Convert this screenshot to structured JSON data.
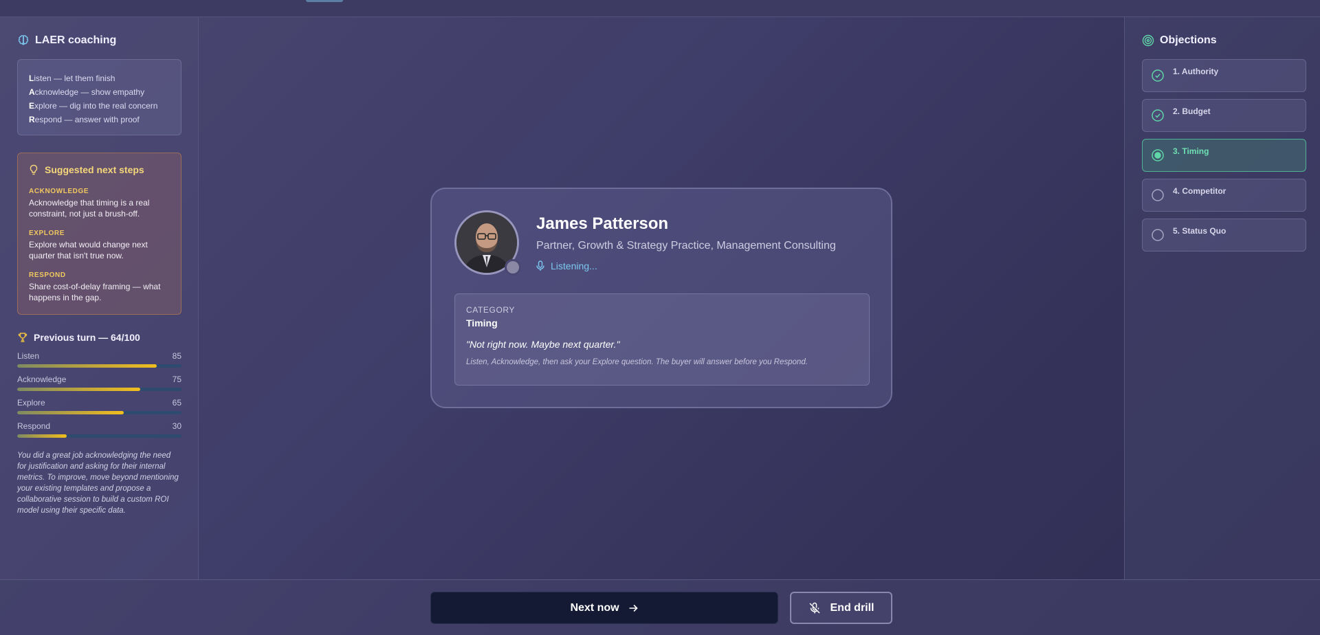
{
  "colors": {
    "accent_green": "#6ee0b4",
    "accent_yellow": "#f5d77a",
    "listening_blue": "#7cc8f0",
    "primary_button": "#141a33"
  },
  "coaching": {
    "title": "LAER coaching",
    "icon": "brain-icon",
    "laer": [
      {
        "letter": "L",
        "rest": "isten — let them finish"
      },
      {
        "letter": "A",
        "rest": "cknowledge — show empathy"
      },
      {
        "letter": "E",
        "rest": "xplore — dig into the real concern"
      },
      {
        "letter": "R",
        "rest": "espond — answer with proof"
      }
    ]
  },
  "suggested": {
    "title": "Suggested next steps",
    "icon": "lightbulb-icon",
    "steps": [
      {
        "label": "ACKNOWLEDGE",
        "text": "Acknowledge that timing is a real constraint, not just a brush-off."
      },
      {
        "label": "EXPLORE",
        "text": "Explore what would change next quarter that isn't true now."
      },
      {
        "label": "RESPOND",
        "text": "Share cost-of-delay framing — what happens in the gap."
      }
    ]
  },
  "previous_turn": {
    "title": "Previous turn — 64/100",
    "icon": "trophy-icon",
    "scores": [
      {
        "label": "Listen",
        "value": 85
      },
      {
        "label": "Acknowledge",
        "value": 75
      },
      {
        "label": "Explore",
        "value": 65
      },
      {
        "label": "Respond",
        "value": 30
      }
    ],
    "feedback": "You did a great job acknowledging the need for justification and asking for their internal metrics. To improve, move beyond mentioning your existing templates and propose a collaborative session to build a custom ROI model using their specific data."
  },
  "buyer": {
    "name": "James Patterson",
    "role": "Partner, Growth & Strategy Practice, Management Consulting",
    "status": "Listening...",
    "category_label": "CATEGORY",
    "category": "Timing",
    "quote": "\"Not right now. Maybe next quarter.\"",
    "hint": "Listen, Acknowledge, then ask your Explore question. The buyer will answer before you Respond."
  },
  "objections": {
    "title": "Objections",
    "icon": "target-icon",
    "items": [
      {
        "label": "1. Authority",
        "state": "done"
      },
      {
        "label": "2. Budget",
        "state": "done"
      },
      {
        "label": "3. Timing",
        "state": "active"
      },
      {
        "label": "4. Competitor",
        "state": "pending"
      },
      {
        "label": "5. Status Quo",
        "state": "pending"
      }
    ]
  },
  "actions": {
    "next_label": "Next now",
    "end_label": "End drill"
  }
}
